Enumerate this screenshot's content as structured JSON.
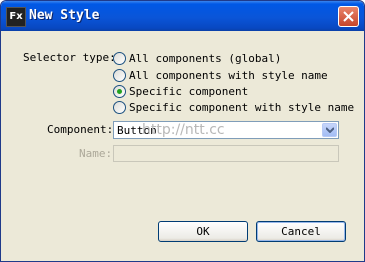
{
  "window": {
    "title": "New Style",
    "app_icon_text": "Fx",
    "close_icon": "close-icon"
  },
  "selector": {
    "label": "Selector type:",
    "options": [
      {
        "label": "All components (global)",
        "checked": false
      },
      {
        "label": "All components with style name",
        "checked": false
      },
      {
        "label": "Specific component",
        "checked": true
      },
      {
        "label": "Specific component with style name",
        "checked": false
      }
    ]
  },
  "component": {
    "label": "Component:",
    "value": "Button",
    "watermark": "http://ntt.cc"
  },
  "name": {
    "label": "Name:",
    "value": "",
    "enabled": false
  },
  "buttons": {
    "ok": "OK",
    "cancel": "Cancel"
  },
  "colors": {
    "titlebar": "#0a55d8",
    "close_button": "#c7452a",
    "dialog_bg": "#ece9d8",
    "radio_dot": "#21a121"
  }
}
